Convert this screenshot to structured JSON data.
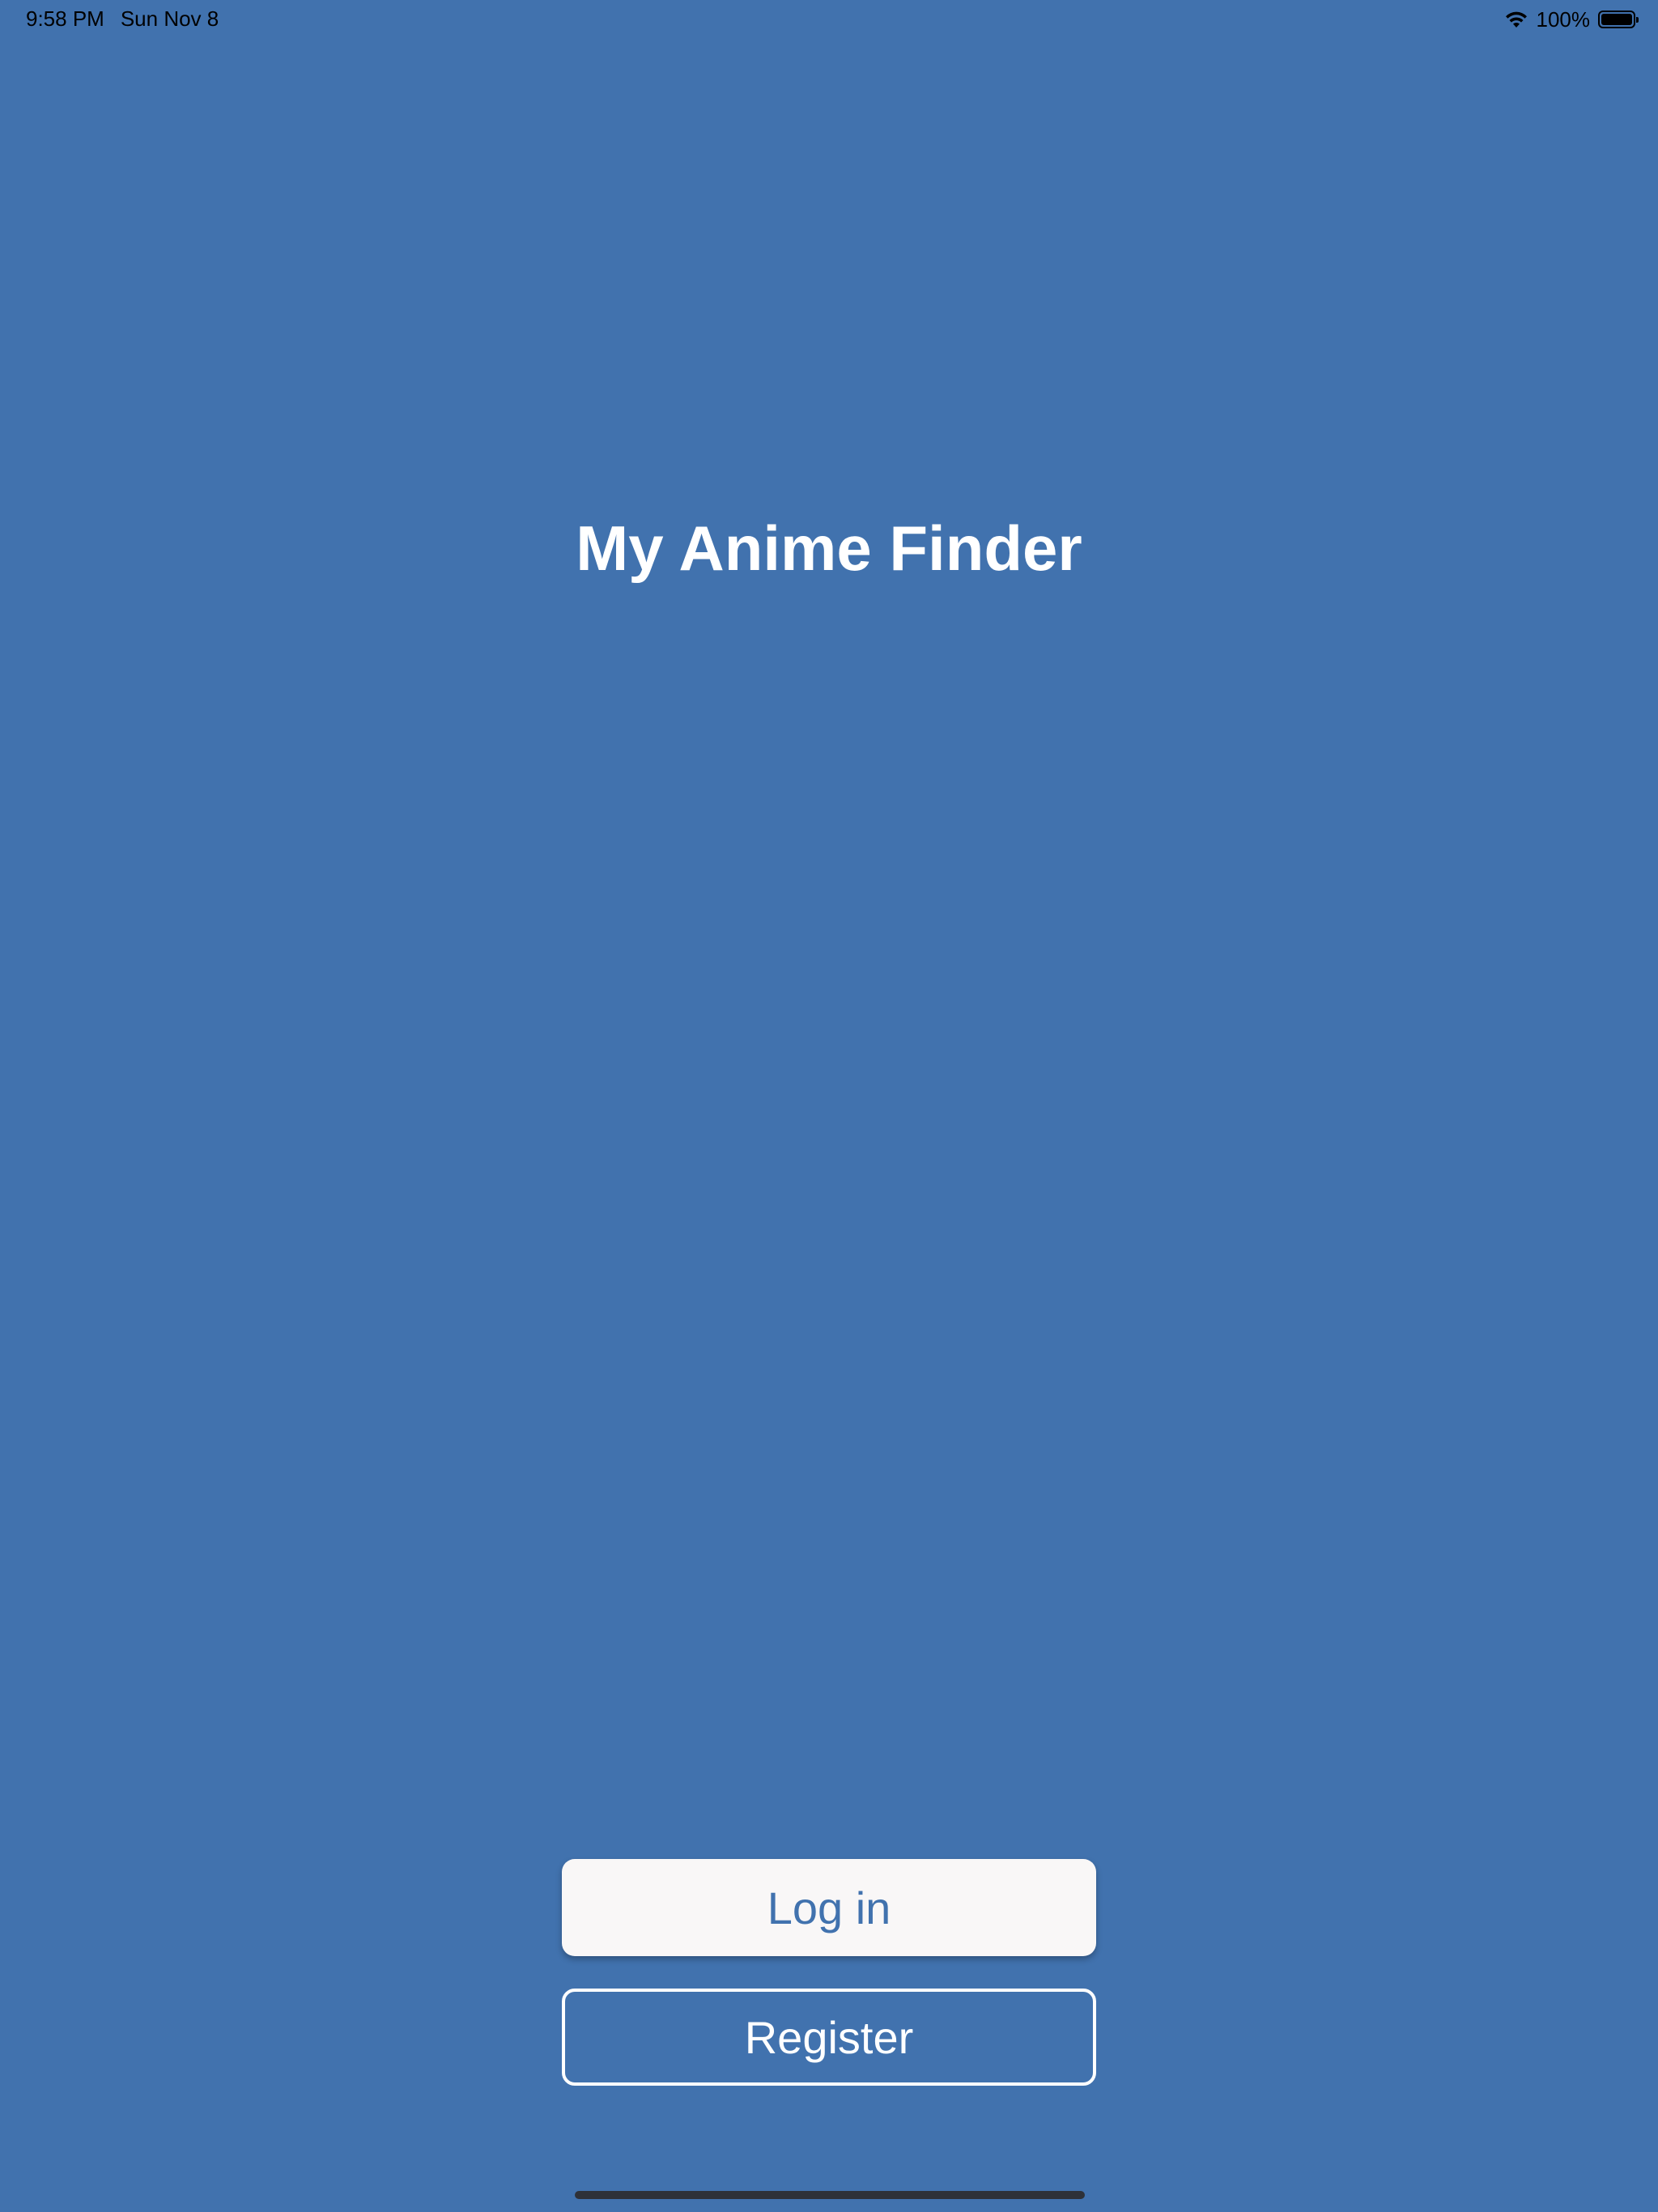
{
  "status_bar": {
    "time": "9:58 PM",
    "date": "Sun Nov 8",
    "battery_percent": "100%",
    "icons": [
      "wifi-icon",
      "battery-icon"
    ]
  },
  "app": {
    "title": "My Anime Finder"
  },
  "buttons": {
    "login_label": "Log in",
    "register_label": "Register"
  },
  "colors": {
    "background": "#4172ae",
    "login_button_bg": "#f9f7f7",
    "login_button_text": "#4172ae",
    "register_border": "#ffffff",
    "title_text": "#ffffff"
  }
}
